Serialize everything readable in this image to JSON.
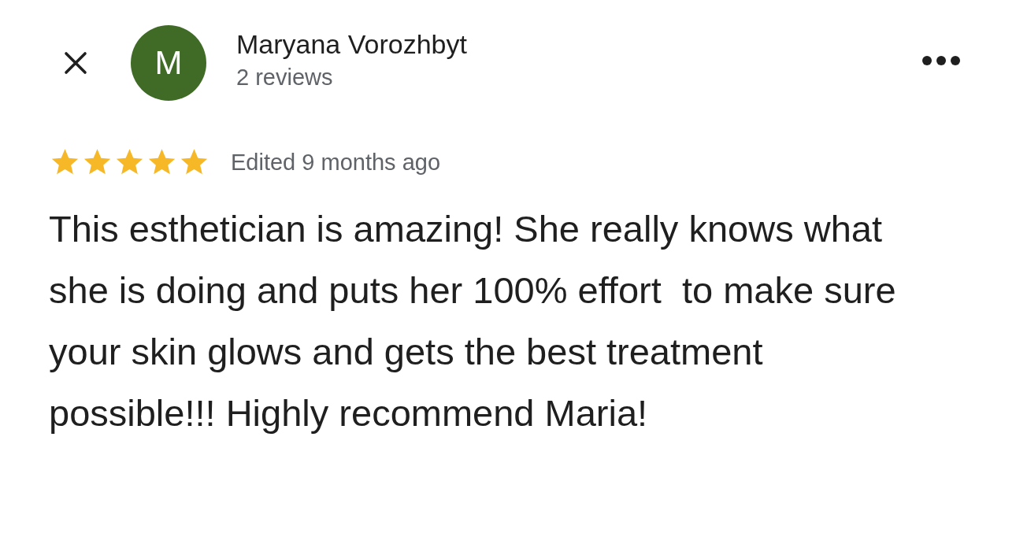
{
  "header": {
    "avatar_letter": "M",
    "name": "Maryana Vorozhbyt",
    "subtitle": "2 reviews"
  },
  "review": {
    "stars": 5,
    "date": "Edited 9 months ago",
    "text": "This esthetician is amazing! She really knows what she is doing and puts her 100% effort  to make sure your skin glows and gets the best treatment possible!!! Highly recommend Maria!"
  }
}
